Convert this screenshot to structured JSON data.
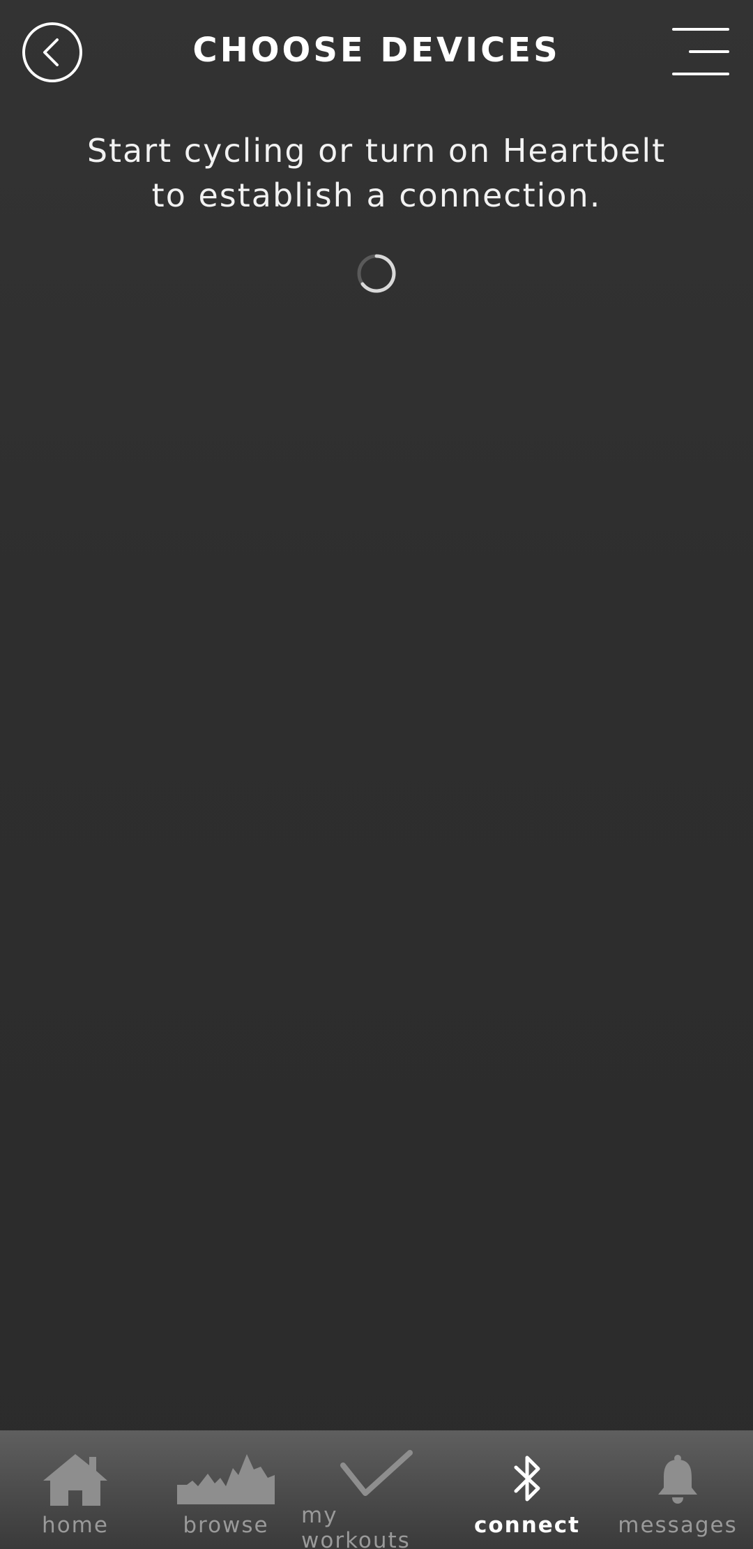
{
  "header": {
    "title": "CHOOSE DEVICES",
    "back_icon": "chevron-left-circle-icon",
    "menu_icon": "menu-icon"
  },
  "main": {
    "instruction_line1": "Start cycling or turn on Heartbelt",
    "instruction_line2": "to establish a connection.",
    "loading": true
  },
  "tabbar": {
    "items": [
      {
        "label": "home",
        "icon": "home-icon",
        "active": false
      },
      {
        "label": "browse",
        "icon": "mountain-profile-icon",
        "active": false
      },
      {
        "label": "my workouts",
        "icon": "checkmark-icon",
        "active": false
      },
      {
        "label": "connect",
        "icon": "bluetooth-icon",
        "active": true
      },
      {
        "label": "messages",
        "icon": "bell-icon",
        "active": false
      }
    ]
  },
  "colors": {
    "background": "#2c2c2c",
    "text": "#ffffff",
    "tab_inactive": "#9a9a9a",
    "tab_active": "#ffffff"
  }
}
